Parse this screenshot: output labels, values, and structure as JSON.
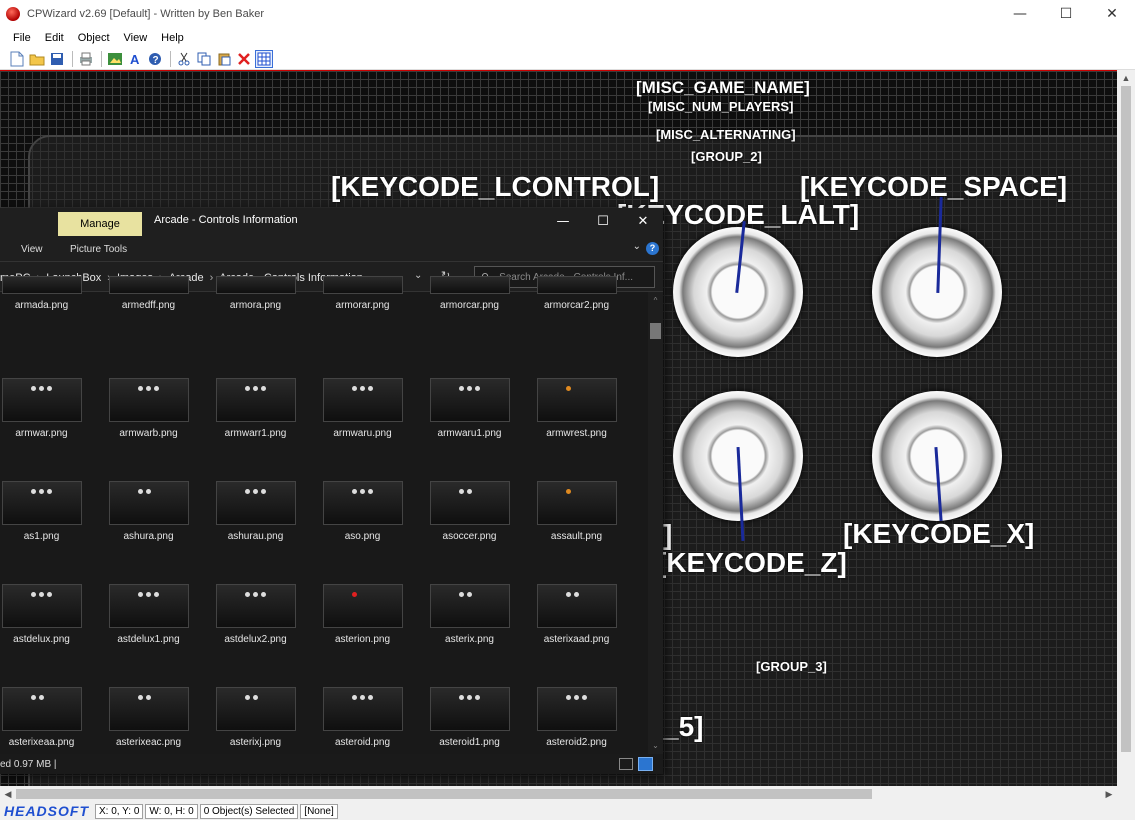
{
  "window": {
    "title": "CPWizard v2.69 [Default] - Written by Ben Baker",
    "minimize": "—",
    "maximize": "☐",
    "close": "✕"
  },
  "menu": [
    "File",
    "Edit",
    "Object",
    "View",
    "Help"
  ],
  "canvas_labels": {
    "game_name": "[MISC_GAME_NAME]",
    "num_players": "[MISC_NUM_PLAYERS]",
    "alternating": "[MISC_ALTERNATING]",
    "group2": "[GROUP_2]",
    "lcontrol": "[KEYCODE_LCONTROL]",
    "space": "[KEYCODE_SPACE]",
    "lalt": "[KEYCODE_LALT]",
    "x": "[KEYCODE_X]",
    "z": "[KEYCODE_Z]",
    "bracket": "]",
    "group3": "[GROUP_3]",
    "partial5": "_5]"
  },
  "status": {
    "logo": "HEADSOFT",
    "coords": "X: 0, Y: 0",
    "size": "W: 0, H: 0",
    "selected": "0 Object(s) Selected",
    "none": "[None]"
  },
  "explorer": {
    "manage": "Manage",
    "title": "Arcade - Controls Information",
    "minimize": "—",
    "maximize": "☐",
    "close": "✕",
    "ribbon_view": "View",
    "ribbon_picture_tools": "Picture Tools",
    "help": "?",
    "chevron": "⌄",
    "path": [
      "mePC",
      "LaunchBox",
      "Images",
      "Arcade",
      "Arcade - Controls Information"
    ],
    "path_sep": "›",
    "dropdown": "⌄",
    "refresh": "↻",
    "search_icon": "⚲",
    "search_placeholder": "Search Arcade - Controls Inf...",
    "status_text": "ed  0.97 MB  |",
    "scroll_up": "^",
    "scroll_down": "⌄",
    "rows": [
      {
        "files": [
          "armada.png",
          "armedff.png",
          "armora.png",
          "armorar.png",
          "armorcar.png",
          "armorcar2.png"
        ],
        "dots": [
          "3",
          "3",
          "3",
          "3",
          "3",
          "3"
        ],
        "partial": true
      },
      {
        "files": [
          "armwar.png",
          "armwarb.png",
          "armwarr1.png",
          "armwaru.png",
          "armwaru1.png",
          "armwrest.png"
        ],
        "dots": [
          "3",
          "3",
          "3",
          "3",
          "3",
          "o"
        ]
      },
      {
        "files": [
          "as1.png",
          "ashura.png",
          "ashurau.png",
          "aso.png",
          "asoccer.png",
          "assault.png"
        ],
        "dots": [
          "3",
          "2",
          "3",
          "3",
          "2",
          "o"
        ]
      },
      {
        "files": [
          "astdelux.png",
          "astdelux1.png",
          "astdelux2.png",
          "asterion.png",
          "asterix.png",
          "asterixaad.png"
        ],
        "dots": [
          "3",
          "3",
          "3",
          "r",
          "2",
          "2"
        ]
      },
      {
        "files": [
          "asterixeaa.png",
          "asterixeac.png",
          "asterixj.png",
          "asteroid.png",
          "asteroid1.png",
          "asteroid2.png"
        ],
        "dots": [
          "2",
          "2",
          "2",
          "3",
          "3",
          "3"
        ]
      }
    ]
  },
  "colors": {
    "accent_blue": "#1f4fd0",
    "canvas_bg": "#0e0e0e",
    "explorer_bg": "#191919",
    "manage_bg": "#e8e2a0",
    "line_blue": "#1a2a9a"
  }
}
